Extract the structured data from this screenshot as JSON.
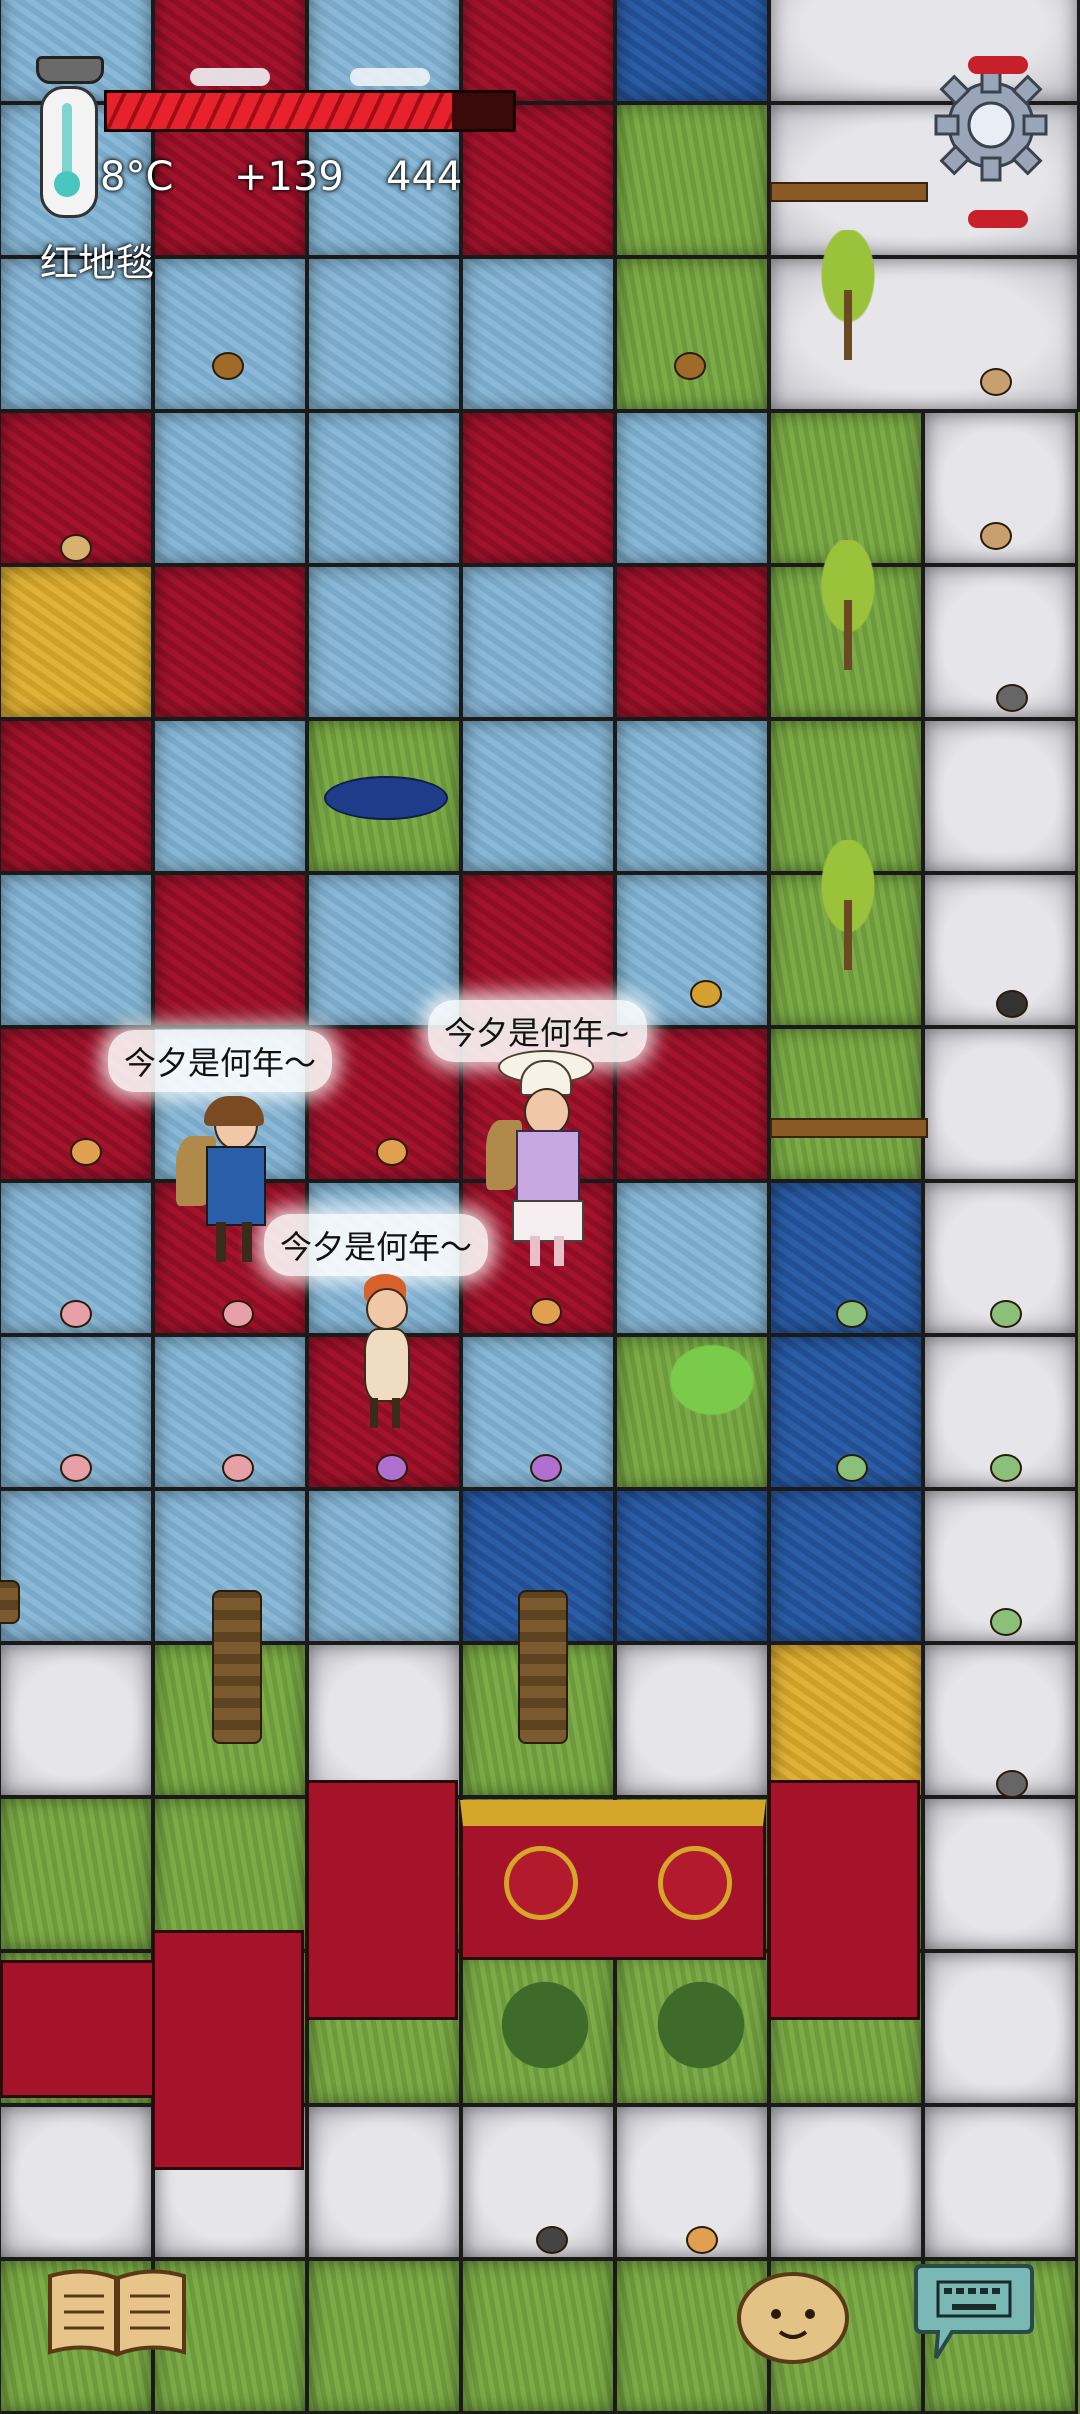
{
  "hud": {
    "temperature": "8°C",
    "bonus": "+139",
    "count": "444",
    "standing_on": "红地毯",
    "health_fraction": 0.85
  },
  "speech": {
    "player_left": "今夕是何年～",
    "player_right": "今夕是何年~",
    "player_center": "今夕是何年～"
  },
  "icons": {
    "thermometer": "thermometer-icon",
    "settings": "gear-icon",
    "recipe_book": "book-icon",
    "emote": "smiley-face-icon",
    "keyboard": "keyboard-icon"
  },
  "colors": {
    "carpet_red": "#a3142c",
    "carpet_light_blue": "#8ab8d6",
    "carpet_blue": "#2a5ea8",
    "carpet_yellow": "#e0b23a",
    "grass": "#7cab48",
    "stone": "#e0e0e4",
    "health_bar": "#e0202a"
  }
}
